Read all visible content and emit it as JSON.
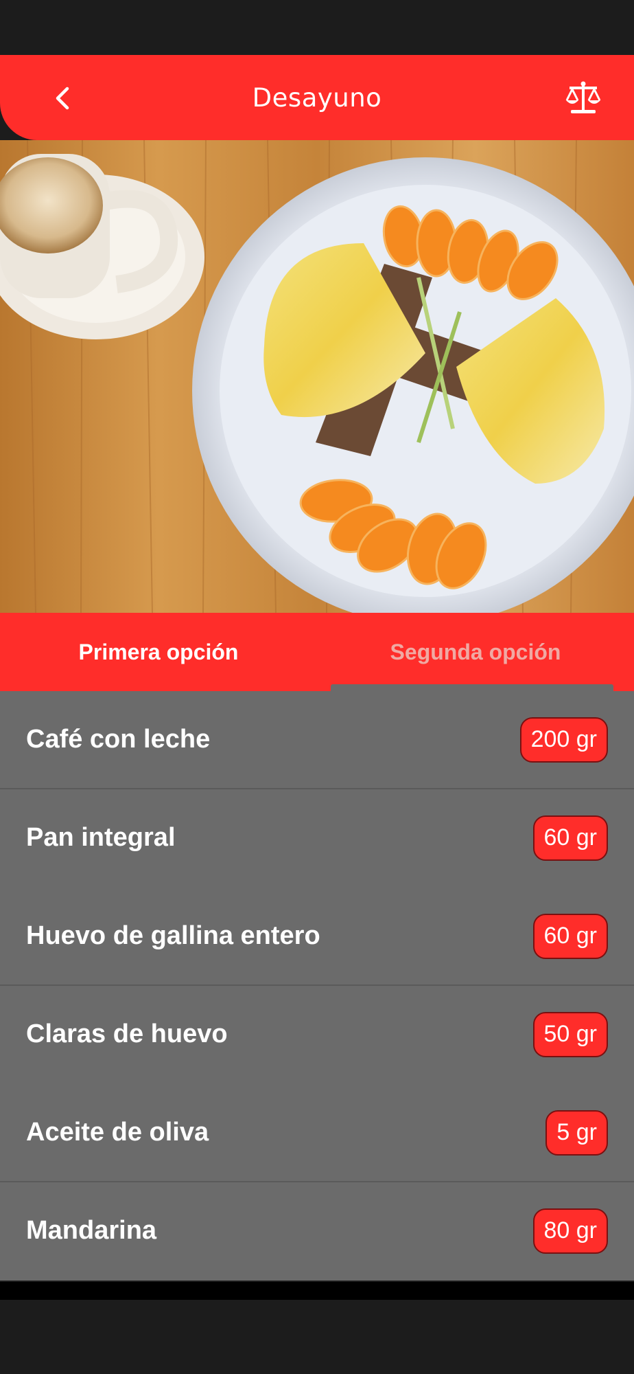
{
  "header": {
    "title": "Desayuno",
    "back_icon": "chevron-left-icon",
    "action_icon": "balance-scale-icon"
  },
  "hero": {
    "image": "breakfast-photo",
    "description_icon": "plate-icon"
  },
  "tabs": [
    {
      "label": "Primera opción",
      "active": true
    },
    {
      "label": "Segunda opción",
      "active": false
    }
  ],
  "items": [
    {
      "name": "Café con leche",
      "amount": "200 gr"
    },
    {
      "name": "Pan integral",
      "amount": "60 gr"
    },
    {
      "name": "Huevo de gallina entero",
      "amount": "60 gr"
    },
    {
      "name": "Claras de huevo",
      "amount": "50 gr"
    },
    {
      "name": "Aceite de oliva",
      "amount": "5 gr"
    },
    {
      "name": "Mandarina",
      "amount": "80 gr"
    }
  ],
  "colors": {
    "brand_red": "#ff2d2a",
    "list_bg": "#6b6b6b",
    "frame": "#1c1c1c"
  }
}
